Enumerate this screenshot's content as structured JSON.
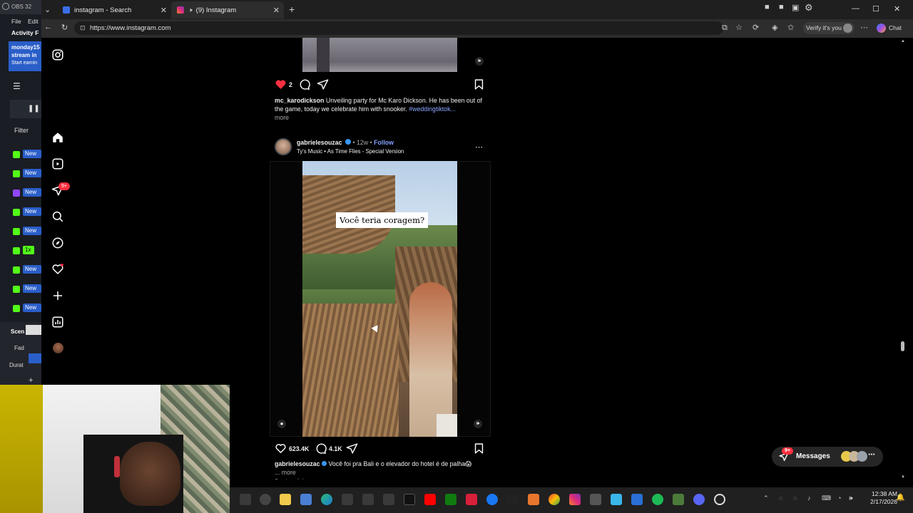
{
  "browser": {
    "tabs": [
      {
        "label": "instagram - Search",
        "active": false
      },
      {
        "label": "(9) Instagram",
        "active": true
      }
    ],
    "url": "https://www.instagram.com",
    "profile_chip": "Verify it's you",
    "copilot_label": "Chat"
  },
  "obs": {
    "title": "OBS 32",
    "menu": [
      "File",
      "Edit"
    ],
    "panel_title": "Activity F",
    "banner_lines": [
      "monday15",
      "stream in",
      "Start earnin"
    ],
    "filter_label": "Filter",
    "rows": [
      "New",
      "New",
      "New",
      "New",
      "New",
      "1x",
      "New",
      "New",
      "New"
    ],
    "scenes_label": "Scen",
    "fade_label": "Fad",
    "duration_label": "Durat"
  },
  "instagram": {
    "notification_badge": "9+",
    "post1": {
      "likes": "2",
      "caption_user": "mc_karodickson",
      "caption_text": "Unveiling party for Mc Karo Dickson. He has been out of the game, today we celebrate him with snooker.",
      "caption_tag": "#weddingtiktok...",
      "more": "more"
    },
    "post2": {
      "username": "gabrielesouzac",
      "time": "12w",
      "follow": "Follow",
      "audio": "Ty's Music • As Time Flies - Special Version",
      "overlay_text": "Você teria coragem?",
      "likes": "623.4K",
      "comments": "4.1K",
      "caption_user": "gabrielesouzac",
      "caption_text": "Você foi pra Bali e o elevador do hotel é de palha😱",
      "more": "... more",
      "see_translation": "See translation"
    },
    "messages": {
      "label": "Messages",
      "badge": "9+"
    }
  },
  "taskbar": {
    "time": "12:38 AM",
    "date": "2/17/2026"
  },
  "colors": {
    "like_red": "#ff3040",
    "link_blue": "#8aa6ff",
    "verified_blue": "#3897f0"
  }
}
